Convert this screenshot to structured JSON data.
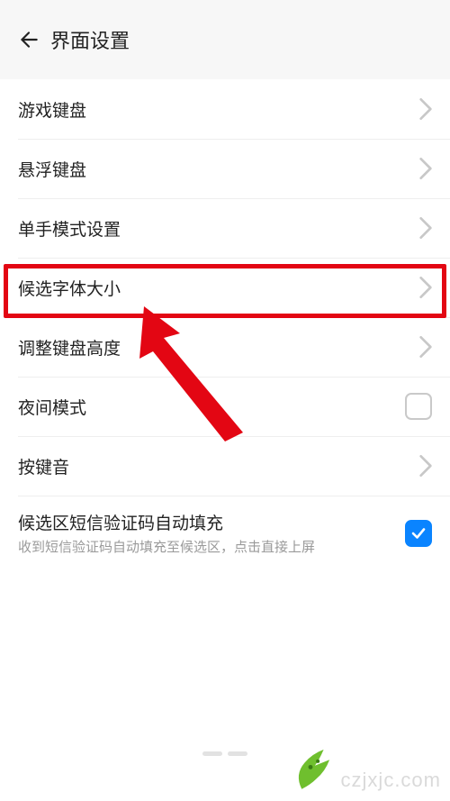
{
  "header": {
    "title": "界面设置"
  },
  "rows": [
    {
      "label": "游戏键盘"
    },
    {
      "label": "悬浮键盘"
    },
    {
      "label": "单手模式设置"
    },
    {
      "label": "候选字体大小"
    },
    {
      "label": "调整键盘高度"
    },
    {
      "label": "夜间模式"
    },
    {
      "label": "按键音"
    },
    {
      "label": "候选区短信验证码自动填充",
      "sub": "收到短信验证码自动填充至候选区，点击直接上屏"
    }
  ],
  "watermark": {
    "text": "czjxjc.com"
  }
}
